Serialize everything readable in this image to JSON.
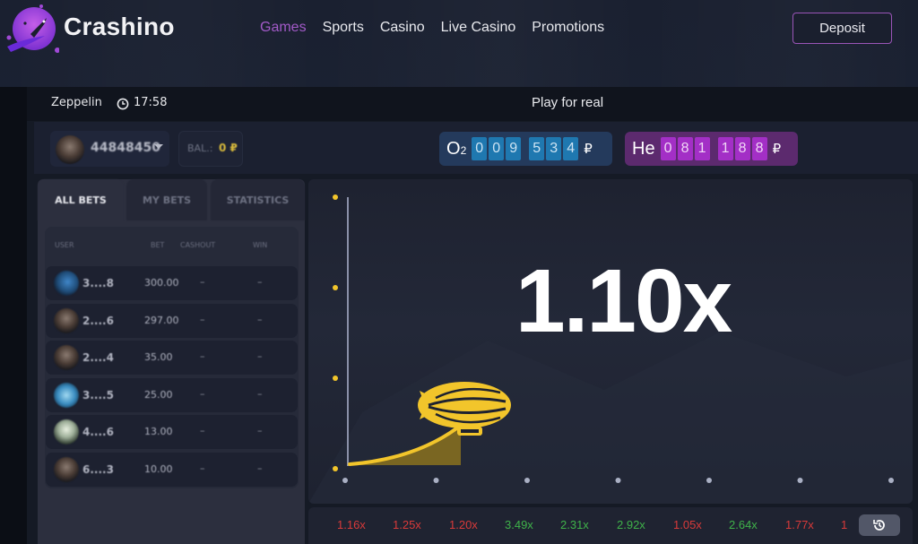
{
  "header": {
    "brand": "Crashino",
    "nav": [
      "Games",
      "Sports",
      "Casino",
      "Live Casino",
      "Promotions"
    ],
    "active_nav": "Games",
    "deposit_label": "Deposit",
    "accent_color": "#a25ac8"
  },
  "game_bar": {
    "game_name": "Zeppelin",
    "time": "17:58",
    "mode_label": "Play for real"
  },
  "user": {
    "id": "44848450",
    "balance_label": "BAL.:",
    "balance_value": "0 ₽"
  },
  "jackpots": {
    "o2": {
      "symbol": "O",
      "subscript": "2",
      "digits": [
        "0",
        "0",
        "9",
        "5",
        "3",
        "4"
      ],
      "currency": "₽",
      "color": "#243a5c"
    },
    "he": {
      "symbol": "He",
      "digits": [
        "0",
        "8",
        "1",
        "1",
        "8",
        "8"
      ],
      "currency": "₽",
      "color": "#5c2a6e"
    }
  },
  "bets_panel": {
    "tabs": [
      "ALL BETS",
      "MY BETS",
      "STATISTICS"
    ],
    "active_tab": "ALL BETS",
    "columns": [
      "USER",
      "BET",
      "CASHOUT",
      "WIN"
    ],
    "rows": [
      {
        "user": "3....8",
        "bet": "300.00",
        "cashout": "–",
        "win": "–",
        "avatar": "globe"
      },
      {
        "user": "2....6",
        "bet": "297.00",
        "cashout": "–",
        "win": "–",
        "avatar": "person"
      },
      {
        "user": "2....4",
        "bet": "35.00",
        "cashout": "–",
        "win": "–",
        "avatar": "person"
      },
      {
        "user": "3....5",
        "bet": "25.00",
        "cashout": "–",
        "win": "–",
        "avatar": "blue"
      },
      {
        "user": "4....6",
        "bet": "13.00",
        "cashout": "–",
        "win": "–",
        "avatar": "mountain"
      },
      {
        "user": "6....3",
        "bet": "10.00",
        "cashout": "–",
        "win": "–",
        "avatar": "person"
      }
    ]
  },
  "game": {
    "multiplier": "1.10x",
    "curve_color": "#f2c52b"
  },
  "history": {
    "items": [
      {
        "value": "1.16x",
        "color": "#d83a3a"
      },
      {
        "value": "1.25x",
        "color": "#d83a3a"
      },
      {
        "value": "1.20x",
        "color": "#d83a3a"
      },
      {
        "value": "3.49x",
        "color": "#3fb24a"
      },
      {
        "value": "2.31x",
        "color": "#3fb24a"
      },
      {
        "value": "2.92x",
        "color": "#3fb24a"
      },
      {
        "value": "1.05x",
        "color": "#d83a3a"
      },
      {
        "value": "2.64x",
        "color": "#3fb24a"
      },
      {
        "value": "1.77x",
        "color": "#d83a3a"
      },
      {
        "value": "1",
        "color": "#d83a3a"
      }
    ],
    "button_icon": "history-icon"
  }
}
